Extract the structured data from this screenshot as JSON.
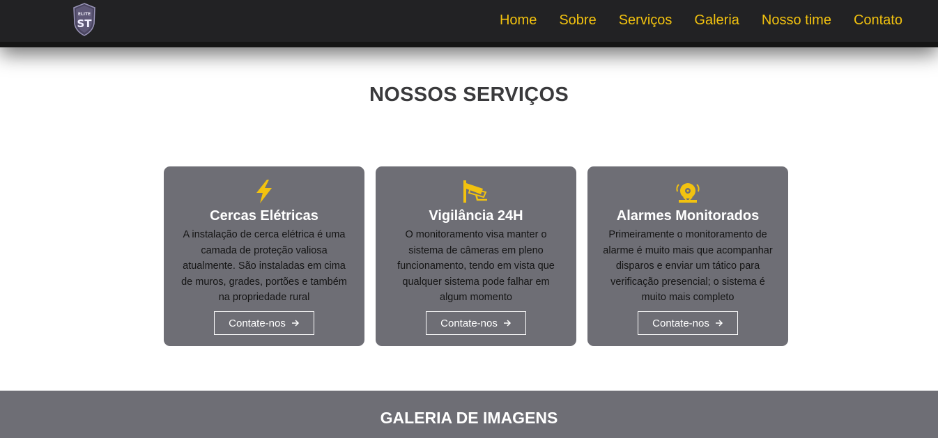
{
  "header": {
    "logo_text": "ELITE ST",
    "nav": [
      "Home",
      "Sobre",
      "Serviços",
      "Galeria",
      "Nosso time",
      "Contato"
    ]
  },
  "services": {
    "title": "NOSSOS SERVIÇOS",
    "cards": [
      {
        "icon": "lightning-bolt-icon",
        "title": "Cercas Elétricas",
        "text": "A instalação de cerca elétrica é uma camada de proteção valiosa atualmente. São instaladas em cima de muros, grades, portões e também na propriedade rural",
        "button": "Contate-nos"
      },
      {
        "icon": "cctv-camera-icon",
        "title": "Vigilância 24H",
        "text": "O monitoramento visa manter o sistema de câmeras em pleno funcionamento, tendo em vista que qualquer sistema pode falhar em algum momento",
        "button": "Contate-nos"
      },
      {
        "icon": "alarm-bell-icon",
        "title": "Alarmes Monitorados",
        "text": "Primeiramente o monitoramento de alarme é muito mais que acompanhar disparos e enviar um tático para verificação presencial; o sistema é muito mais completo",
        "button": "Contate-nos"
      }
    ]
  },
  "gallery": {
    "title": "GALERIA DE IMAGENS"
  },
  "colors": {
    "accent": "#f2c20f",
    "header_bg": "#222224",
    "card_bg": "#6e6e75",
    "title_text": "#3a3a3c"
  }
}
